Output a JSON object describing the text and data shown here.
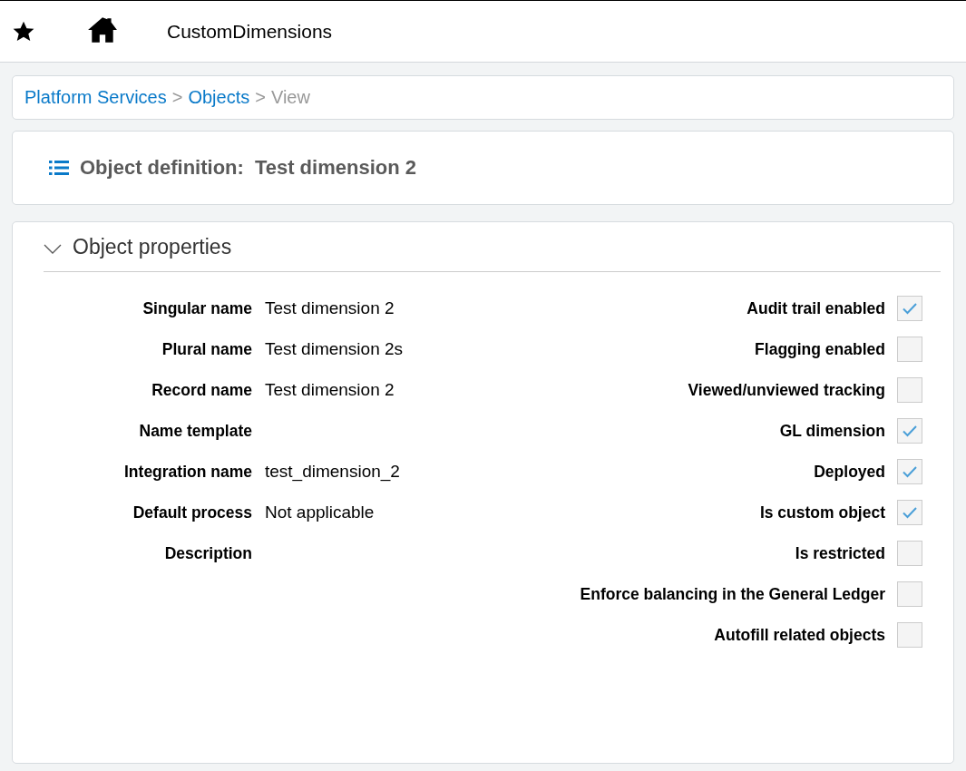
{
  "top_bar": {
    "title": "CustomDimensions"
  },
  "breadcrumb": [
    {
      "label": "Platform Services",
      "kind": "link"
    },
    {
      "label": "Objects",
      "kind": "link"
    },
    {
      "label": "View",
      "kind": "current"
    }
  ],
  "breadcrumb_separator": ">",
  "header": {
    "label": "Object definition:",
    "value": "Test dimension 2"
  },
  "section": {
    "title": "Object properties",
    "expanded": true,
    "fields": [
      {
        "label": "Singular name",
        "value": "Test dimension 2"
      },
      {
        "label": "Plural name",
        "value": "Test dimension 2s"
      },
      {
        "label": "Record name",
        "value": "Test dimension 2"
      },
      {
        "label": "Name template"
      },
      {
        "label": "Integration name",
        "value": "test_dimension_2"
      },
      {
        "label": "Default process",
        "value": "Not applicable"
      },
      {
        "label": "Description"
      }
    ],
    "flags": [
      {
        "label": "Audit trail enabled",
        "checked": true
      },
      {
        "label": "Flagging enabled",
        "checked": false
      },
      {
        "label": "Viewed/unviewed tracking",
        "checked": false
      },
      {
        "label": "GL dimension",
        "checked": true
      },
      {
        "label": "Deployed",
        "checked": true
      },
      {
        "label": "Is custom object",
        "checked": true
      },
      {
        "label": "Is restricted",
        "checked": false
      },
      {
        "label": "Enforce balancing in the General Ledger",
        "checked": false
      },
      {
        "label": "Autofill related objects",
        "checked": false
      }
    ]
  }
}
